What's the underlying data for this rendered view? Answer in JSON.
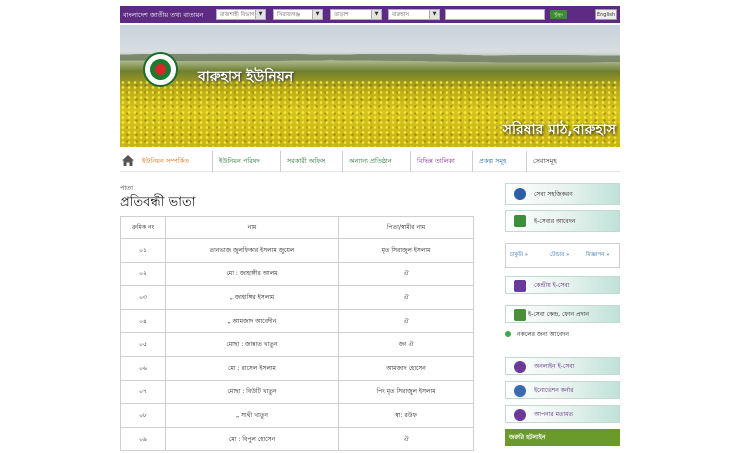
{
  "topbar": {
    "brand": "বাংলাদেশ জাতীয় তথ্য বাতায়ন",
    "selects": [
      "রাজশাহী বিভাগ",
      "সিরাজগঞ্জ",
      "তাড়াশ",
      "বারুহাস"
    ],
    "search_button": "খুঁজুন",
    "language_button": "English"
  },
  "banner": {
    "union_name": "বারুহাস ইউনিয়ন",
    "caption": "সরিষার মাঠ,বারুহাস"
  },
  "nav": {
    "items": [
      "ইউনিয়ন সম্পর্কিত",
      "ইউনিয়ন পরিষদ",
      "সরকারী অফিস",
      "অন্যান্য প্রতিষ্ঠান",
      "বিভিন্ন তালিকা",
      "প্রকল্প সমূহ",
      "সেবাসমূহ"
    ]
  },
  "main": {
    "breadcrumb": "পাতা",
    "title": "প্রতিবন্ধী ভাতা",
    "table": {
      "headers": [
        "ক্রমিক নং",
        "নাম",
        "পিতা/স্বামীর নাম"
      ],
      "rows": [
        [
          "০১",
          "তানভাজ জুলফিকার ইসলাম জুয়েল",
          "মৃত সিরাজুল ইসলাম"
        ],
        [
          "০২",
          "মো : জাহাঙ্গীর আলম",
          "ঐ"
        ],
        [
          "০৩",
          "„ জাহাঙ্গির ইসলাম",
          "ঐ"
        ],
        [
          "০৪",
          "„ আমজাদ আবেদীন",
          "ঐ"
        ],
        [
          "০৫",
          "মোছা : জান্নাত খাতুন",
          "জং ঐ"
        ],
        [
          "০৬",
          "মো : রাসেল ইসলাম",
          "আমজাদ হোসেন"
        ],
        [
          "০৭",
          "মোছা : বিউটি খাতুন",
          "পিং মৃত সিরাজুল ইসলাম"
        ],
        [
          "০৮",
          "„ সাথী খাতুন",
          "স্বা: রউফ"
        ],
        [
          "০৯",
          "মো : বিপুল হোসেন",
          "ঐ"
        ]
      ]
    }
  },
  "sidebar": {
    "service_box": "সেবা সহজিকরণ",
    "eservice_apply": "ই-সেবার আবেদন",
    "tabs": [
      "চাকুরি",
      "টেন্ডার",
      "বিজ্ঞাপন"
    ],
    "central_eservice": "কেন্দ্রীয় ই-সেবা",
    "eservice_center": "ই-সেবা কেন্দ্র, ফোন প্রদান",
    "nokol_link": "নকলের জন্য আবেদন",
    "online_eservice": "অনলাইন ই-সেবা",
    "innovation_corner": "ইনোভেশন কর্নার",
    "your_opinion": "আপনার মতামত",
    "hotline": "জরুরি হটলাইন"
  },
  "colors": {
    "topbar_bg": "#5d2a84",
    "nav_text": "#1f6e2f",
    "nav_active": "#e36b0a",
    "accent_blue": "#1f6aa6",
    "hotline_bg": "#6a9a2a"
  }
}
